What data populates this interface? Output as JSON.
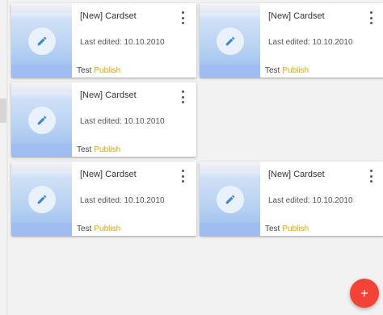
{
  "cards": [
    {
      "title": "[New] Cardset",
      "last_edited": "Last edited: 10.10.2010",
      "tag": "Test",
      "action": "Publish"
    },
    {
      "title": "[New] Cardset",
      "last_edited": "Last edited: 10.10.2010",
      "tag": "Test",
      "action": "Publish"
    },
    {
      "title": "[New] Cardset",
      "last_edited": "Last edited: 10.10.2010",
      "tag": "Test",
      "action": "Publish"
    },
    {
      "title": "[New] Cardset",
      "last_edited": "Last edited: 10.10.2010",
      "tag": "Test",
      "action": "Publish"
    },
    {
      "title": "[New] Cardset",
      "last_edited": "Last edited: 10.10.2010",
      "tag": "Test",
      "action": "Publish"
    }
  ],
  "icons": {
    "edit": "pencil-icon",
    "menu": "more-vertical-icon",
    "fab": "plus-icon"
  },
  "colors": {
    "accent": "#e4a400",
    "fab": "#f44336",
    "edit_icon": "#3d86d8"
  }
}
